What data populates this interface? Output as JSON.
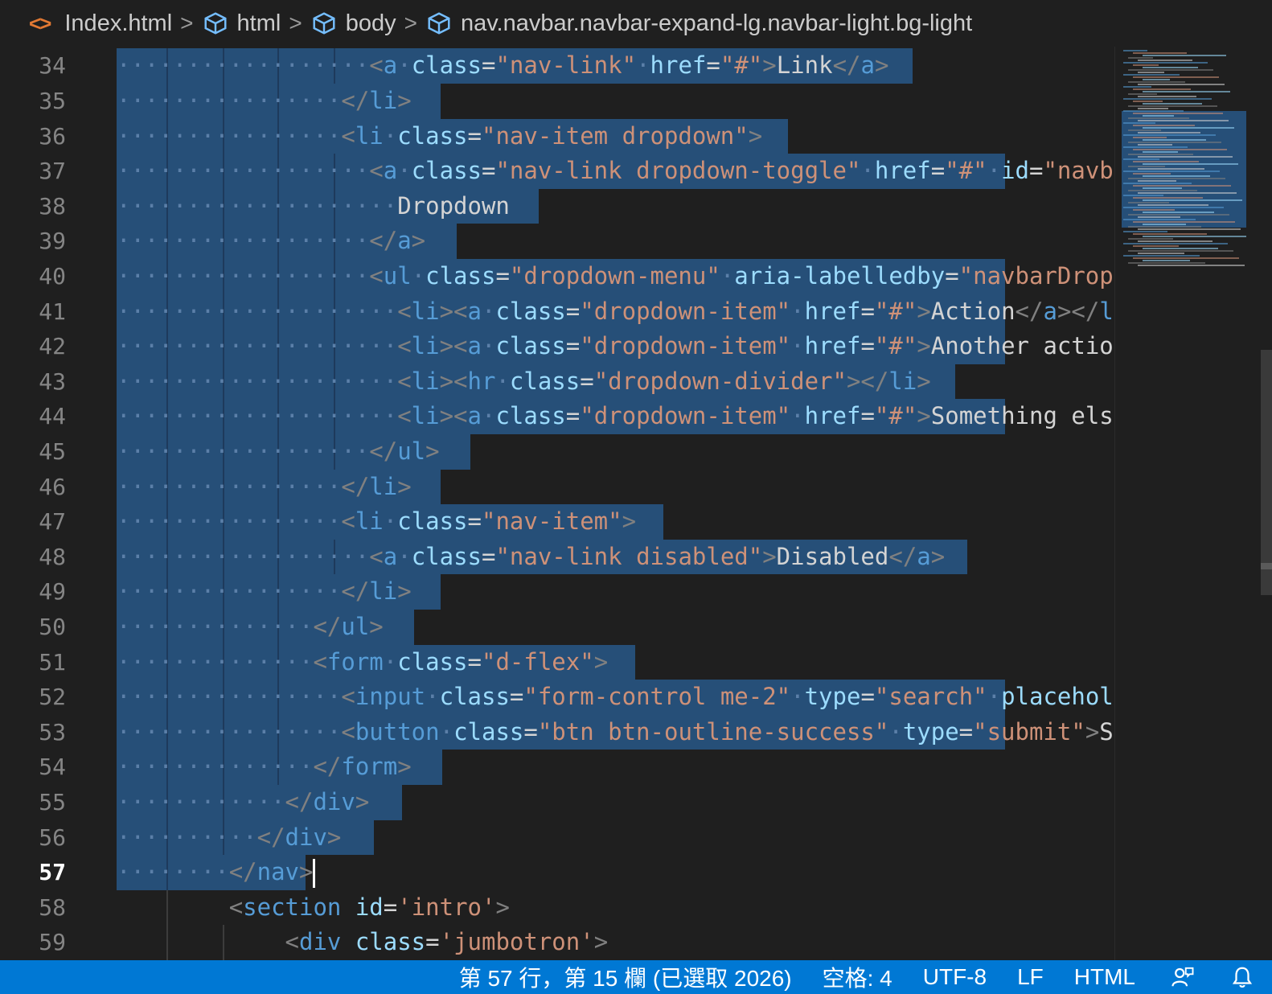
{
  "breadcrumb": {
    "file_icon": "html-file-icon",
    "file": "Index.html",
    "items": [
      "html",
      "body",
      "nav.navbar.navbar-expand-lg.navbar-light.bg-light"
    ]
  },
  "editor": {
    "first_line": 34,
    "current_line": 57,
    "lines": [
      {
        "n": "34",
        "indent": 9,
        "sel_end": 1135,
        "tokens": [
          [
            "t",
            "<"
          ],
          [
            "tag",
            "a"
          ],
          [
            "txt",
            " "
          ],
          [
            "attr",
            "class"
          ],
          [
            "txt",
            "="
          ],
          [
            "str",
            "\"nav-link\""
          ],
          [
            "txt",
            " "
          ],
          [
            "attr",
            "href"
          ],
          [
            "txt",
            "="
          ],
          [
            "str",
            "\"#\""
          ],
          [
            "t",
            ">"
          ],
          [
            "txt",
            "Link"
          ],
          [
            "t",
            "</"
          ],
          [
            "tag",
            "a"
          ],
          [
            "t",
            ">"
          ]
        ]
      },
      {
        "n": "35",
        "indent": 8,
        "sel_end": 548,
        "tokens": [
          [
            "t",
            "</"
          ],
          [
            "tag",
            "li"
          ],
          [
            "t",
            ">"
          ]
        ]
      },
      {
        "n": "36",
        "indent": 8,
        "sel_end": 980,
        "tokens": [
          [
            "t",
            "<"
          ],
          [
            "tag",
            "li"
          ],
          [
            "txt",
            " "
          ],
          [
            "attr",
            "class"
          ],
          [
            "txt",
            "="
          ],
          [
            "str",
            "\"nav-item dropdown\""
          ],
          [
            "t",
            ">"
          ]
        ]
      },
      {
        "n": "37",
        "indent": 9,
        "sel_end": 1250,
        "tokens": [
          [
            "t",
            "<"
          ],
          [
            "tag",
            "a"
          ],
          [
            "txt",
            " "
          ],
          [
            "attr",
            "class"
          ],
          [
            "txt",
            "="
          ],
          [
            "str",
            "\"nav-link dropdown-toggle\""
          ],
          [
            "txt",
            " "
          ],
          [
            "attr",
            "href"
          ],
          [
            "txt",
            "="
          ],
          [
            "str",
            "\"#\""
          ],
          [
            "txt",
            " "
          ],
          [
            "attr",
            "id"
          ],
          [
            "txt",
            "="
          ],
          [
            "str",
            "\"navbarDropdown\""
          ]
        ]
      },
      {
        "n": "38",
        "indent": 10,
        "sel_end": 670,
        "tokens": [
          [
            "txt",
            "Dropdown"
          ]
        ]
      },
      {
        "n": "39",
        "indent": 9,
        "sel_end": 568,
        "tokens": [
          [
            "t",
            "</"
          ],
          [
            "tag",
            "a"
          ],
          [
            "t",
            ">"
          ]
        ]
      },
      {
        "n": "40",
        "indent": 9,
        "sel_end": 1250,
        "tokens": [
          [
            "t",
            "<"
          ],
          [
            "tag",
            "ul"
          ],
          [
            "txt",
            " "
          ],
          [
            "attr",
            "class"
          ],
          [
            "txt",
            "="
          ],
          [
            "str",
            "\"dropdown-menu\""
          ],
          [
            "txt",
            " "
          ],
          [
            "attr",
            "aria-labelledby"
          ],
          [
            "txt",
            "="
          ],
          [
            "str",
            "\"navbarDropdown\""
          ]
        ]
      },
      {
        "n": "41",
        "indent": 10,
        "sel_end": 1250,
        "tokens": [
          [
            "t",
            "<"
          ],
          [
            "tag",
            "li"
          ],
          [
            "t",
            "><"
          ],
          [
            "tag",
            "a"
          ],
          [
            "txt",
            " "
          ],
          [
            "attr",
            "class"
          ],
          [
            "txt",
            "="
          ],
          [
            "str",
            "\"dropdown-item\""
          ],
          [
            "txt",
            " "
          ],
          [
            "attr",
            "href"
          ],
          [
            "txt",
            "="
          ],
          [
            "str",
            "\"#\""
          ],
          [
            "t",
            ">"
          ],
          [
            "txt",
            "Action"
          ],
          [
            "t",
            "</"
          ],
          [
            "tag",
            "a"
          ],
          [
            "t",
            "></"
          ],
          [
            "tag",
            "li"
          ],
          [
            "t",
            ">"
          ]
        ]
      },
      {
        "n": "42",
        "indent": 10,
        "sel_end": 1250,
        "tokens": [
          [
            "t",
            "<"
          ],
          [
            "tag",
            "li"
          ],
          [
            "t",
            "><"
          ],
          [
            "tag",
            "a"
          ],
          [
            "txt",
            " "
          ],
          [
            "attr",
            "class"
          ],
          [
            "txt",
            "="
          ],
          [
            "str",
            "\"dropdown-item\""
          ],
          [
            "txt",
            " "
          ],
          [
            "attr",
            "href"
          ],
          [
            "txt",
            "="
          ],
          [
            "str",
            "\"#\""
          ],
          [
            "t",
            ">"
          ],
          [
            "txt",
            "Another action"
          ]
        ]
      },
      {
        "n": "43",
        "indent": 10,
        "sel_end": 1188,
        "tokens": [
          [
            "t",
            "<"
          ],
          [
            "tag",
            "li"
          ],
          [
            "t",
            "><"
          ],
          [
            "tag",
            "hr"
          ],
          [
            "txt",
            " "
          ],
          [
            "attr",
            "class"
          ],
          [
            "txt",
            "="
          ],
          [
            "str",
            "\"dropdown-divider\""
          ],
          [
            "t",
            "></"
          ],
          [
            "tag",
            "li"
          ],
          [
            "t",
            ">"
          ]
        ]
      },
      {
        "n": "44",
        "indent": 10,
        "sel_end": 1250,
        "tokens": [
          [
            "t",
            "<"
          ],
          [
            "tag",
            "li"
          ],
          [
            "t",
            "><"
          ],
          [
            "tag",
            "a"
          ],
          [
            "txt",
            " "
          ],
          [
            "attr",
            "class"
          ],
          [
            "txt",
            "="
          ],
          [
            "str",
            "\"dropdown-item\""
          ],
          [
            "txt",
            " "
          ],
          [
            "attr",
            "href"
          ],
          [
            "txt",
            "="
          ],
          [
            "str",
            "\"#\""
          ],
          [
            "t",
            ">"
          ],
          [
            "txt",
            "Something else here"
          ]
        ]
      },
      {
        "n": "45",
        "indent": 9,
        "sel_end": 585,
        "tokens": [
          [
            "t",
            "</"
          ],
          [
            "tag",
            "ul"
          ],
          [
            "t",
            ">"
          ]
        ]
      },
      {
        "n": "46",
        "indent": 8,
        "sel_end": 548,
        "tokens": [
          [
            "t",
            "</"
          ],
          [
            "tag",
            "li"
          ],
          [
            "t",
            ">"
          ]
        ]
      },
      {
        "n": "47",
        "indent": 8,
        "sel_end": 825,
        "tokens": [
          [
            "t",
            "<"
          ],
          [
            "tag",
            "li"
          ],
          [
            "txt",
            " "
          ],
          [
            "attr",
            "class"
          ],
          [
            "txt",
            "="
          ],
          [
            "str",
            "\"nav-item\""
          ],
          [
            "t",
            ">"
          ]
        ]
      },
      {
        "n": "48",
        "indent": 9,
        "sel_end": 1203,
        "tokens": [
          [
            "t",
            "<"
          ],
          [
            "tag",
            "a"
          ],
          [
            "txt",
            " "
          ],
          [
            "attr",
            "class"
          ],
          [
            "txt",
            "="
          ],
          [
            "str",
            "\"nav-link disabled\""
          ],
          [
            "t",
            ">"
          ],
          [
            "txt",
            "Disabled"
          ],
          [
            "t",
            "</"
          ],
          [
            "tag",
            "a"
          ],
          [
            "t",
            ">"
          ]
        ]
      },
      {
        "n": "49",
        "indent": 8,
        "sel_end": 548,
        "tokens": [
          [
            "t",
            "</"
          ],
          [
            "tag",
            "li"
          ],
          [
            "t",
            ">"
          ]
        ]
      },
      {
        "n": "50",
        "indent": 7,
        "sel_end": 515,
        "tokens": [
          [
            "t",
            "</"
          ],
          [
            "tag",
            "ul"
          ],
          [
            "t",
            ">"
          ]
        ]
      },
      {
        "n": "51",
        "indent": 7,
        "sel_end": 790,
        "tokens": [
          [
            "t",
            "<"
          ],
          [
            "tag",
            "form"
          ],
          [
            "txt",
            " "
          ],
          [
            "attr",
            "class"
          ],
          [
            "txt",
            "="
          ],
          [
            "str",
            "\"d-flex\""
          ],
          [
            "t",
            ">"
          ]
        ]
      },
      {
        "n": "52",
        "indent": 8,
        "sel_end": 1250,
        "tokens": [
          [
            "t",
            "<"
          ],
          [
            "tag",
            "input"
          ],
          [
            "txt",
            " "
          ],
          [
            "attr",
            "class"
          ],
          [
            "txt",
            "="
          ],
          [
            "str",
            "\"form-control me-2\""
          ],
          [
            "txt",
            " "
          ],
          [
            "attr",
            "type"
          ],
          [
            "txt",
            "="
          ],
          [
            "str",
            "\"search\""
          ],
          [
            "txt",
            " "
          ],
          [
            "attr",
            "placeholder"
          ]
        ]
      },
      {
        "n": "53",
        "indent": 8,
        "sel_end": 1250,
        "tokens": [
          [
            "t",
            "<"
          ],
          [
            "tag",
            "button"
          ],
          [
            "txt",
            " "
          ],
          [
            "attr",
            "class"
          ],
          [
            "txt",
            "="
          ],
          [
            "str",
            "\"btn btn-outline-success\""
          ],
          [
            "txt",
            " "
          ],
          [
            "attr",
            "type"
          ],
          [
            "txt",
            "="
          ],
          [
            "str",
            "\"submit\""
          ],
          [
            "t",
            ">"
          ],
          [
            "txt",
            "Search"
          ]
        ]
      },
      {
        "n": "54",
        "indent": 7,
        "sel_end": 550,
        "tokens": [
          [
            "t",
            "</"
          ],
          [
            "tag",
            "form"
          ],
          [
            "t",
            ">"
          ]
        ]
      },
      {
        "n": "55",
        "indent": 6,
        "sel_end": 500,
        "tokens": [
          [
            "t",
            "</"
          ],
          [
            "tag",
            "div"
          ],
          [
            "t",
            ">"
          ]
        ]
      },
      {
        "n": "56",
        "indent": 5,
        "sel_end": 465,
        "tokens": [
          [
            "t",
            "</"
          ],
          [
            "tag",
            "div"
          ],
          [
            "t",
            ">"
          ]
        ]
      },
      {
        "n": "57",
        "indent": 4,
        "sel_end": 380,
        "cursor": true,
        "tokens": [
          [
            "t",
            "</"
          ],
          [
            "tag",
            "nav"
          ],
          [
            "t",
            ">"
          ]
        ]
      },
      {
        "n": "58",
        "indent": 4,
        "sel_end": 0,
        "tokens": [
          [
            "t",
            "<"
          ],
          [
            "tag",
            "section"
          ],
          [
            "txt",
            " "
          ],
          [
            "attr",
            "id"
          ],
          [
            "txt",
            "="
          ],
          [
            "str",
            "'intro'"
          ],
          [
            "t",
            ">"
          ]
        ]
      },
      {
        "n": "59",
        "indent": 6,
        "sel_end": 0,
        "tokens": [
          [
            "t",
            "<"
          ],
          [
            "tag",
            "div"
          ],
          [
            "txt",
            " "
          ],
          [
            "attr",
            "class"
          ],
          [
            "txt",
            "="
          ],
          [
            "str",
            "'jumbotron'"
          ],
          [
            "t",
            ">"
          ]
        ]
      }
    ]
  },
  "status": {
    "position": "第 57 行，第 15 欄 (已選取 2026)",
    "spaces": "空格: 4",
    "encoding": "UTF-8",
    "eol": "LF",
    "language": "HTML",
    "feedback_icon": "feedback-icon",
    "bell_icon": "bell-icon"
  },
  "colors": {
    "background": "#1f1f1f",
    "selection": "#264f78",
    "statusbar": "#0078d4",
    "tag": "#569cd6",
    "attribute": "#9cdcfe",
    "string": "#ce9178"
  }
}
